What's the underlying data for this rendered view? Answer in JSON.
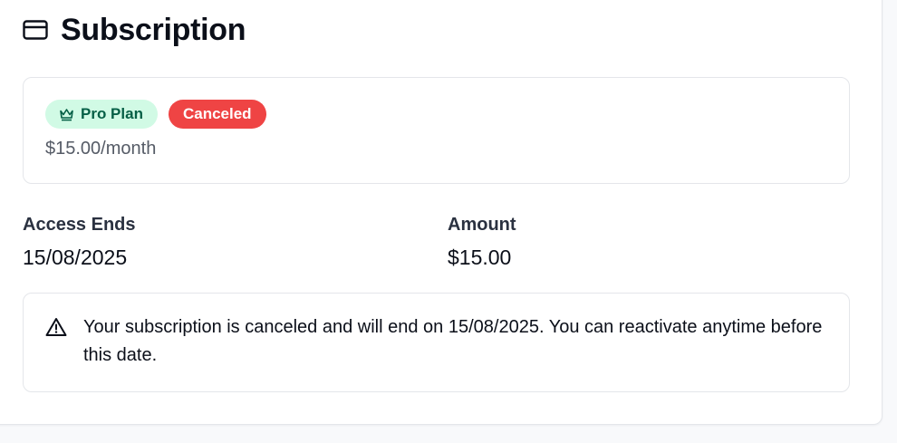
{
  "header": {
    "icon": "credit-card-icon",
    "title": "Subscription"
  },
  "plan": {
    "name_badge": "Pro Plan",
    "name_badge_icon": "crown-icon",
    "status_badge": "Canceled",
    "price": "$15.00/month"
  },
  "details": {
    "access_ends_label": "Access Ends",
    "access_ends_value": "15/08/2025",
    "amount_label": "Amount",
    "amount_value": "$15.00"
  },
  "alert": {
    "icon": "warning-triangle-icon",
    "message": "Your subscription is canceled and will end on 15/08/2025. You can reactivate anytime before this date."
  },
  "colors": {
    "pro_badge_bg": "#d1fae5",
    "pro_badge_text": "#065f46",
    "canceled_badge_bg": "#ef4444"
  }
}
